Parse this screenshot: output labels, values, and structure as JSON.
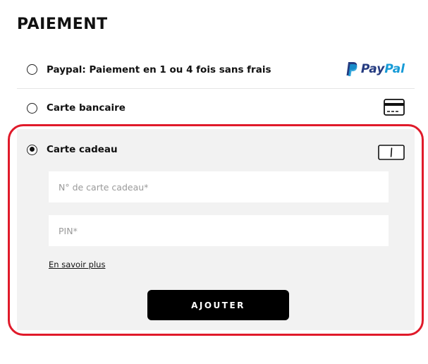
{
  "page": {
    "title": "PAIEMENT"
  },
  "payment_options": {
    "paypal": {
      "label": "Paypal: Paiement en 1 ou 4 fois sans frais",
      "logo_text_pay": "Pay",
      "logo_text_pal": "Pal",
      "selected": false,
      "icon": "paypal-logo"
    },
    "card": {
      "label": "Carte bancaire",
      "selected": false,
      "icon": "credit-card-icon"
    },
    "gift_card": {
      "label": "Carte cadeau",
      "selected": true,
      "icon": "gift-card-icon",
      "card_number_placeholder": "N° de carte cadeau*",
      "card_number_value": "",
      "pin_placeholder": "PIN*",
      "pin_value": "",
      "learn_more": "En savoir plus",
      "add_button": "AJOUTER"
    }
  },
  "colors": {
    "highlight_border": "#e01a2a",
    "panel_background": "#f2f2f2",
    "button_background": "#000000",
    "paypal_dark": "#253b80",
    "paypal_light": "#179bd7"
  }
}
